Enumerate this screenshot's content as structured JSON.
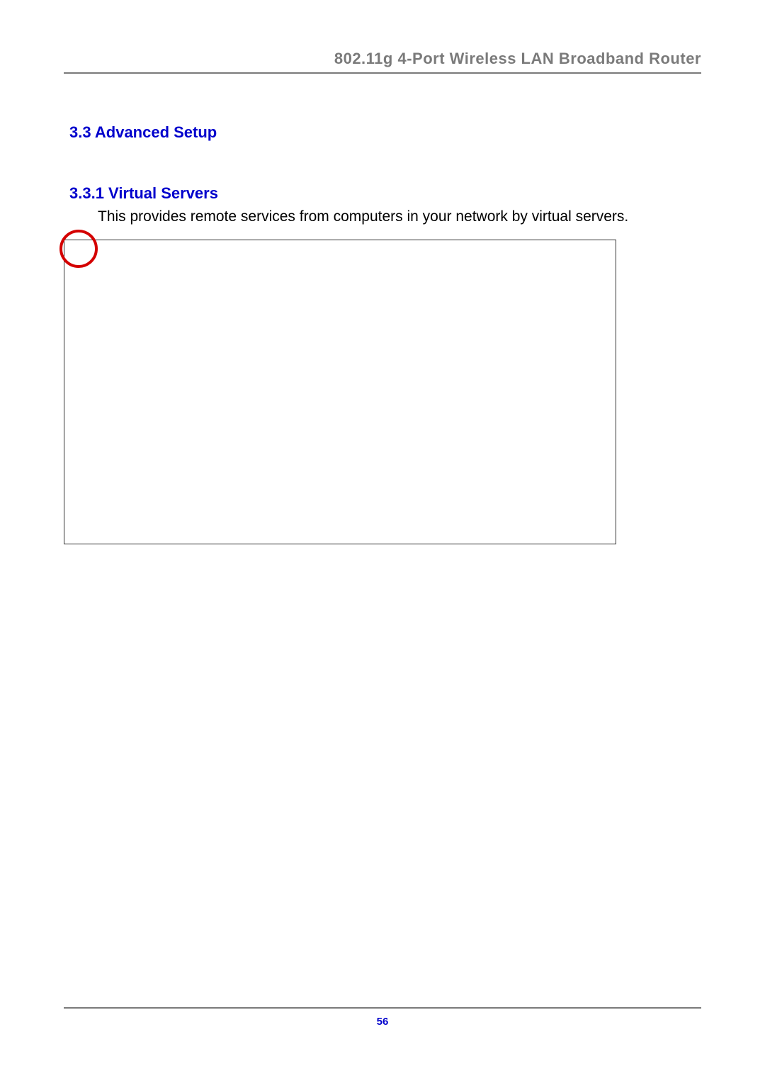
{
  "header": {
    "title": "802.11g 4-Port Wireless LAN Broadband Router"
  },
  "section": {
    "heading": "3.3 Advanced Setup"
  },
  "subsection": {
    "heading": "3.3.1 Virtual Servers",
    "body": "This provides remote services from computers in your network by virtual servers."
  },
  "footer": {
    "page_number": "56"
  },
  "annotation": {
    "circle_color": "#d40000"
  }
}
